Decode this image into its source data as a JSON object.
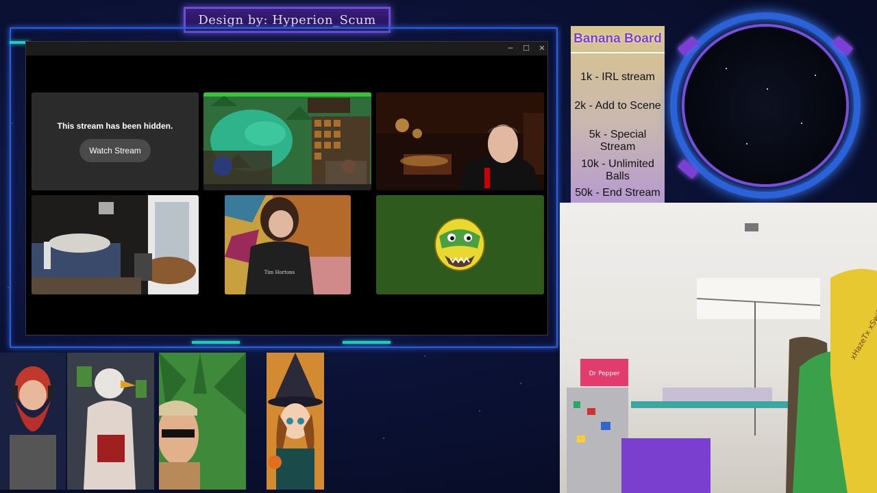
{
  "overlay": {
    "designer_banner": "Design by: Hyperion_Scum"
  },
  "window": {
    "controls": {
      "minimize": "─",
      "maximize": "☐",
      "close": "✕"
    },
    "hidden_tile": {
      "message": "This stream has been hidden.",
      "button_label": "Watch Stream"
    },
    "shirt_text": "Tim Hortons"
  },
  "banana_board": {
    "title": "Banana Board",
    "items": [
      "1k - IRL stream",
      "2k - Add to Scene",
      "5k - Special Stream",
      "10k - Unlimited Balls",
      "50k - End Stream"
    ]
  },
  "webcam": {
    "box_label": "Dr Pepper",
    "hat_text": "xHazeTx xSwifey x Coopz Greenl NotMalo"
  },
  "colors": {
    "frame_blue": "#2d5fd8",
    "accent_cyan": "#21c9c9",
    "banner_purple": "#3a1d7c",
    "board_title_purple": "#7c3fc9",
    "hidden_tile_bg": "#2b2b2b",
    "emote_bg": "#2f5a1e"
  }
}
